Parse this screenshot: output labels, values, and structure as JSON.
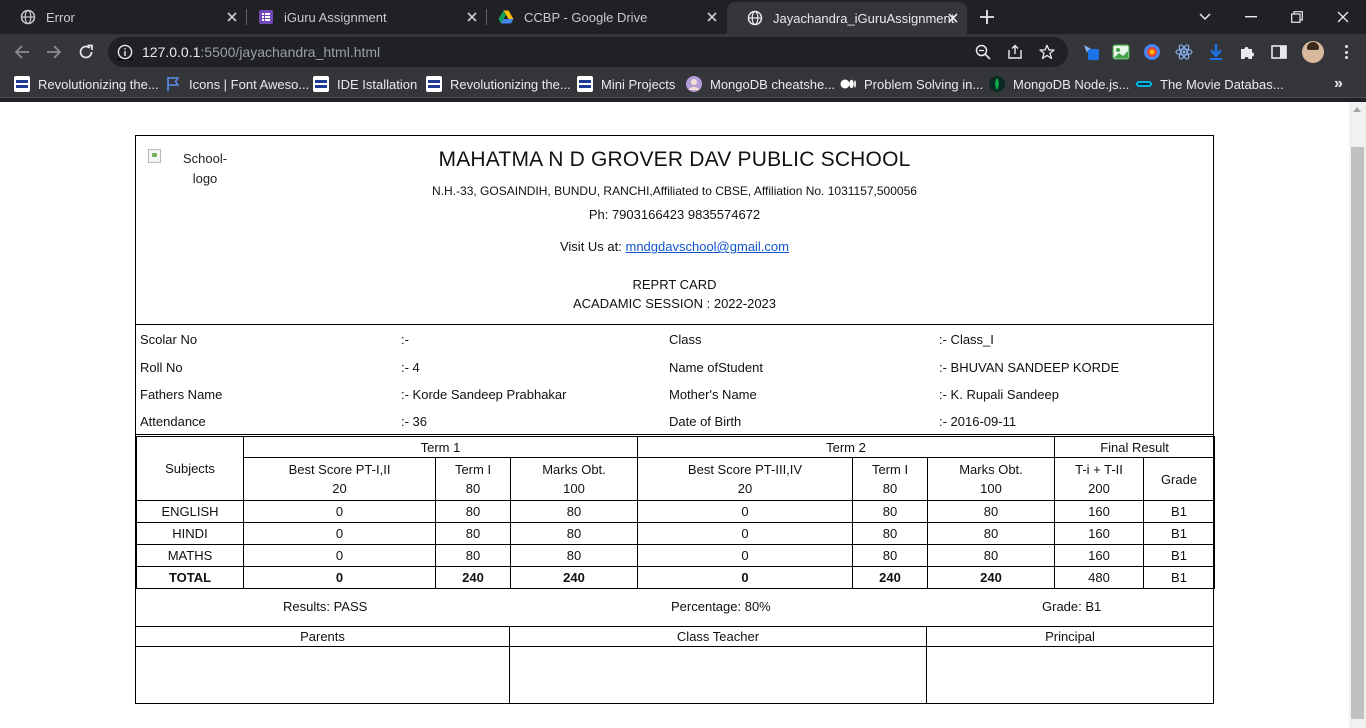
{
  "browser": {
    "tabs": [
      {
        "title": "Error",
        "icon": "globe-icon",
        "active": false
      },
      {
        "title": "iGuru Assignment",
        "icon": "forms-icon",
        "active": false
      },
      {
        "title": "CCBP - Google Drive",
        "icon": "google-drive-icon",
        "active": false
      },
      {
        "title": "Jayachandra_iGuruAssignment",
        "icon": "globe-icon",
        "active": true
      }
    ],
    "url_host": "127.0.0.1",
    "url_rest": ":5500/jayachandra_html.html",
    "bookmarks": [
      {
        "label": "Revolutionizing the...",
        "icon": "nxtwave-icon"
      },
      {
        "label": "Icons | Font Aweso...",
        "icon": "flag-icon"
      },
      {
        "label": "IDE Istallation",
        "icon": "nxtwave-icon"
      },
      {
        "label": "Revolutionizing the...",
        "icon": "nxtwave-icon"
      },
      {
        "label": "Mini Projects",
        "icon": "nxtwave-icon"
      },
      {
        "label": "MongoDB cheatshe...",
        "icon": "avatar-icon"
      },
      {
        "label": "Problem Solving in...",
        "icon": "medium-icon"
      },
      {
        "label": "MongoDB Node.js...",
        "icon": "mongodb-leaf-icon"
      },
      {
        "label": "The Movie Databas...",
        "icon": "tmdb-icon"
      }
    ],
    "colors": {
      "tabbar": "#202124",
      "toolbar": "#35363a",
      "accent": "#8ab4f8"
    }
  },
  "report": {
    "logo_alt": "School-logo",
    "school_name": "MAHATMA N D GROVER DAV PUBLIC SCHOOL",
    "address": "N.H.-33, GOSAINDIH, BUNDU, RANCHI,Affiliated to CBSE, Affiliation No. 1031157,500056",
    "phone": "Ph: 7903166423 9835574672",
    "visit_label": "Visit Us at:",
    "email": "mndgdavschool@gmail.com",
    "title": "REPRT CARD",
    "session": "ACADAMIC SESSION : 2022-2023",
    "student": {
      "scolar_no_label": "Scolar No",
      "scolar_no": ":-",
      "class_label": "Class",
      "class": ":- Class_I",
      "roll_no_label": "Roll No",
      "roll_no": ":- 4",
      "name_label": "Name ofStudent",
      "name": ":- BHUVAN SANDEEP KORDE",
      "father_label": "Fathers Name",
      "father": ":- Korde Sandeep Prabhakar",
      "mother_label": "Mother's Name",
      "mother": ":- K. Rupali Sandeep",
      "attendance_label": "Attendance",
      "attendance": ":- 36",
      "dob_label": "Date of Birth",
      "dob": ":- 2016-09-11"
    },
    "marks": {
      "subjects_label": "Subjects",
      "term1": "Term 1",
      "term2": "Term 2",
      "final": "Final Result",
      "cols": {
        "t1_best": "Best Score PT-I,II",
        "t1_best_max": "20",
        "t1_term": "Term I",
        "t1_term_max": "80",
        "t1_obt": "Marks Obt.",
        "t1_obt_max": "100",
        "t2_best": "Best Score PT-III,IV",
        "t2_best_max": "20",
        "t2_term": "Term I",
        "t2_term_max": "80",
        "t2_obt": "Marks Obt.",
        "t2_obt_max": "100",
        "total": "T-i + T-II",
        "total_max": "200",
        "grade": "Grade"
      },
      "rows": [
        [
          "ENGLISH",
          "0",
          "80",
          "80",
          "0",
          "80",
          "80",
          "160",
          "B1"
        ],
        [
          "HINDI",
          "0",
          "80",
          "80",
          "0",
          "80",
          "80",
          "160",
          "B1"
        ],
        [
          "MATHS",
          "0",
          "80",
          "80",
          "0",
          "80",
          "80",
          "160",
          "B1"
        ]
      ],
      "total_row": [
        "TOTAL",
        "0",
        "240",
        "240",
        "0",
        "240",
        "240",
        "480",
        "B1"
      ]
    },
    "results": "Results: PASS",
    "percentage": "Percentage: 80%",
    "grade": "Grade: B1",
    "signatures": [
      "Parents",
      "Class Teacher",
      "Principal"
    ]
  }
}
